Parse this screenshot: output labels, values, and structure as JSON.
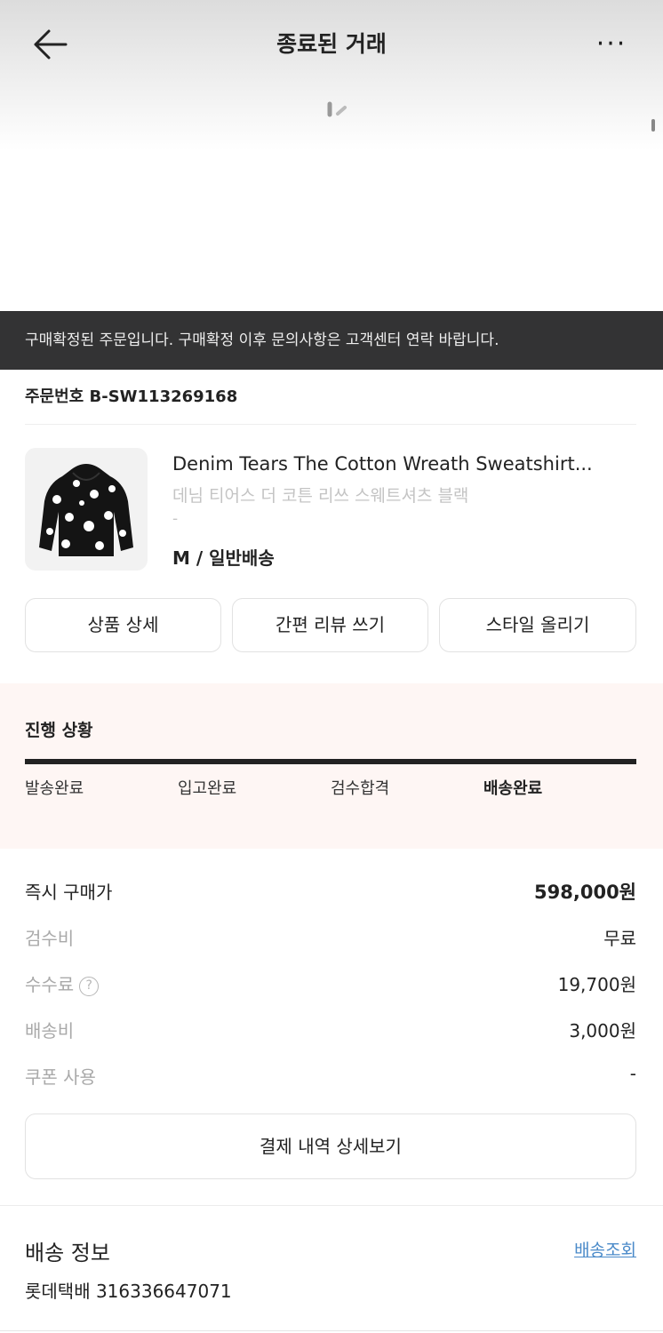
{
  "header": {
    "title": "종료된 거래",
    "back_icon": "arrow-left-icon",
    "more_icon": "more-horizontal-icon",
    "more_label": "···"
  },
  "notice": {
    "text": "구매확정된 주문입니다. 구매확정 이후 문의사항은 고객센터 연락 바랍니다."
  },
  "order": {
    "number": "주문번호 B-SW113269168"
  },
  "product": {
    "name": "Denim Tears The Cotton Wreath Sweatshirt...",
    "name_ko": "데님 티어스 더 코튼 리쓰 스웨트셔츠 블랙",
    "extra": "-",
    "option": "M / 일반배송"
  },
  "actions": [
    {
      "label": "상품 상세"
    },
    {
      "label": "간편 리뷰 쓰기"
    },
    {
      "label": "스타일 올리기"
    }
  ],
  "progress": {
    "title": "진행 상황",
    "steps": [
      "발송완료",
      "입고완료",
      "검수합격",
      "배송완료"
    ],
    "active_step": "배송완료"
  },
  "price": {
    "rows": [
      {
        "label": "즉시 구매가",
        "value": "598,000원"
      },
      {
        "label": "검수비",
        "value": "무료"
      },
      {
        "label": "수수료",
        "value": "19,700원"
      },
      {
        "label": "배송비",
        "value": "3,000원"
      },
      {
        "label": "쿠폰 사용",
        "value": "-"
      }
    ],
    "help_icon": "question-circle-icon",
    "detail_button": "결제 내역 상세보기"
  },
  "shipping": {
    "title": "배송 정보",
    "track_link": "배송조회",
    "carrier_tracking": "롯데택배 316336647071"
  },
  "colors": {
    "notice_bg": "#333334",
    "progress_bg": "#fef6f4",
    "link": "#4a8ac9",
    "muted": "#a9a9a9"
  }
}
